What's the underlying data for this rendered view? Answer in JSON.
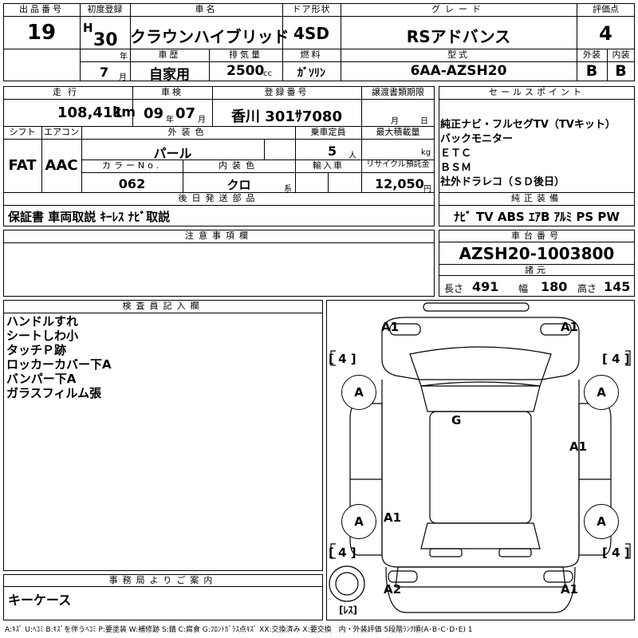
{
  "top": {
    "lot_no": {
      "label": "出品番号",
      "value": "19"
    },
    "first_reg": {
      "label": "初度登録",
      "era": "H",
      "year": "30",
      "year_unit": "年",
      "month": "7",
      "month_unit": "月"
    },
    "car_name": {
      "label": "車名",
      "value": "クラウンハイブリッド"
    },
    "door": {
      "label": "ドア形状",
      "value": "4SD"
    },
    "grade": {
      "label": "グレード",
      "value": "RSアドバンス"
    },
    "score": {
      "label": "評価点",
      "value": "4"
    },
    "history": {
      "label": "車歴",
      "value": "自家用"
    },
    "displacement": {
      "label": "排気量",
      "value": "2500",
      "unit": "cc"
    },
    "fuel": {
      "label": "燃料",
      "value": "ｶﾞｿﾘﾝ"
    },
    "model": {
      "label": "型式",
      "value": "6AA-AZSH20"
    },
    "exterior": {
      "label": "外装",
      "value": "B"
    },
    "interior": {
      "label": "内装",
      "value": "B"
    }
  },
  "middle": {
    "mileage": {
      "label": "走行",
      "value": "108,411",
      "unit": "km"
    },
    "inspection": {
      "label": "車検",
      "year": "09",
      "year_unit": "年",
      "month": "07",
      "month_unit": "月"
    },
    "plate": {
      "label": "登録番号",
      "value": "香川 301ｻ7080"
    },
    "transfer": {
      "label": "譲渡書類期限",
      "month_unit": "月",
      "day_unit": "日"
    },
    "shift": {
      "label": "シフト",
      "value": "FAT"
    },
    "aircon": {
      "label": "エアコン",
      "value": "AAC"
    },
    "ext_color": {
      "label": "外装色",
      "value": "パール"
    },
    "capacity": {
      "label": "乗車定員",
      "value": "5",
      "unit": "人"
    },
    "max_load": {
      "label": "最大積載量",
      "unit": "kg"
    },
    "color_no": {
      "label": "カラーNo.",
      "value": "062"
    },
    "int_color": {
      "label": "内装色",
      "value": "クロ",
      "unit": "系"
    },
    "import": {
      "label": "輸入車"
    },
    "recycle": {
      "label": "リサイクル預託金",
      "value": "12,050",
      "unit": "円"
    },
    "later_parts": {
      "label": "後日発送部品",
      "value": "保証書 車両取説 ｷｰﾚｽ ﾅﾋﾞ取説"
    }
  },
  "sales_points": {
    "label": "セールスポイント",
    "items": [
      "純正ナビ・フルセグTV（TVキット）",
      "バックモニター",
      "ＥＴＣ",
      "ＢＳＭ",
      "社外ドラレコ（ＳＤ後日）"
    ]
  },
  "equipment": {
    "label": "純正装備",
    "value": "ﾅﾋﾞ TV ABS ｴｱB ｱﾙﾐ PS PW"
  },
  "chassis": {
    "label": "車台番号",
    "value": "AZSH20-1003800"
  },
  "specs": {
    "label": "諸元",
    "length_label": "長さ",
    "length": "491",
    "width_label": "幅",
    "width": "180",
    "height_label": "高さ",
    "height": "145"
  },
  "notes": {
    "label": "注意事項欄"
  },
  "inspector": {
    "label": "検査員記入欄",
    "items": [
      "ハンドルすれ",
      "シートしわ小",
      "タッチＰ跡",
      "ロッカーカバー下A",
      "バンパー下A",
      "ガラスフィルム張"
    ]
  },
  "office": {
    "label": "事務局よりご案内",
    "value": "キーケース"
  },
  "diagram": {
    "marks": {
      "front_left": "A1",
      "front_right": "A1",
      "center": "G",
      "right_side": "A1",
      "rear_left_side": "A1",
      "rear_left": "A2",
      "rear_right": "A1",
      "tire_fl": "A",
      "tire_fr": "A",
      "tire_rl": "A",
      "tire_rr": "A"
    },
    "tire_tread": "[ 4 ]",
    "spare_label": "[ﾚｽ]"
  },
  "legend": "A:ｷｽﾞ U:ﾍｺﾐ B:ｷｽﾞを伴うﾍｺﾐ P:要塗装 W:補修跡 S:錆 C:腐食 G:ﾌﾛﾝﾄｶﾞﾗｽ点ｷｽﾞ XX:交換済み X:要交換　内・外装評価 5段階ﾗﾝｸ順(A･B･C･D･E) 1"
}
